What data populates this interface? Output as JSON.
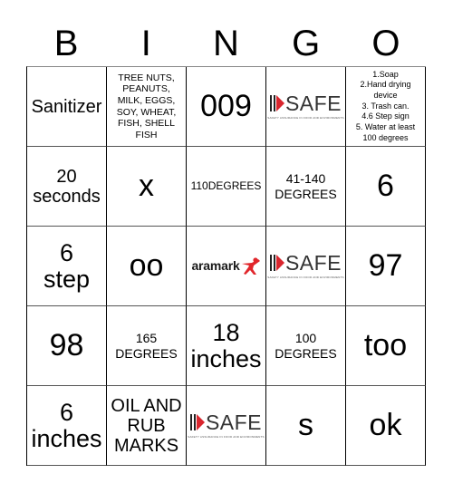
{
  "title_letters": [
    "B",
    "I",
    "N",
    "G",
    "O"
  ],
  "logos": {
    "safe": {
      "word": "SAFE",
      "tagline": "SAFETY ASSURANCE IN FOOD AND ENVIRONMENTS",
      "accent_color": "#d9262e"
    },
    "aramark": {
      "word": "aramark",
      "accent_color": "#e1262b"
    }
  },
  "board": {
    "rows": [
      [
        {
          "text": "Sanitizer",
          "size": "md"
        },
        {
          "text": "TREE NUTS,\nPEANUTS,\nMILK, EGGS,\nSOY, WHEAT,\nFISH, SHELL\nFISH",
          "size": "xxs"
        },
        {
          "text": "009",
          "size": "xl"
        },
        {
          "logo": "safe"
        },
        {
          "text": "1.Soap\n2.Hand drying\ndevice\n3. Trash can.\n4.6 Step sign\n5. Water at least\n100 degrees",
          "size": "xxxs"
        }
      ],
      [
        {
          "text": "20\nseconds",
          "size": "md"
        },
        {
          "text": "x",
          "size": "xl"
        },
        {
          "text": "110DEGREES",
          "size": "xs"
        },
        {
          "text": "41-140\nDEGREES",
          "size": "sm"
        },
        {
          "text": "6",
          "size": "xl"
        }
      ],
      [
        {
          "text": "6\nstep",
          "size": "lg"
        },
        {
          "text": "oo",
          "size": "xl"
        },
        {
          "logo": "aramark"
        },
        {
          "logo": "safe"
        },
        {
          "text": "97",
          "size": "xl"
        }
      ],
      [
        {
          "text": "98",
          "size": "xl"
        },
        {
          "text": "165\nDEGREES",
          "size": "sm"
        },
        {
          "text": "18\ninches",
          "size": "lg"
        },
        {
          "text": "100\nDEGREES",
          "size": "sm"
        },
        {
          "text": "too",
          "size": "xl"
        }
      ],
      [
        {
          "text": "6\ninches",
          "size": "lg"
        },
        {
          "text": "OIL AND\nRUB\nMARKS",
          "size": "md"
        },
        {
          "logo": "safe"
        },
        {
          "text": "s",
          "size": "xl"
        },
        {
          "text": "ok",
          "size": "xl"
        }
      ]
    ]
  }
}
